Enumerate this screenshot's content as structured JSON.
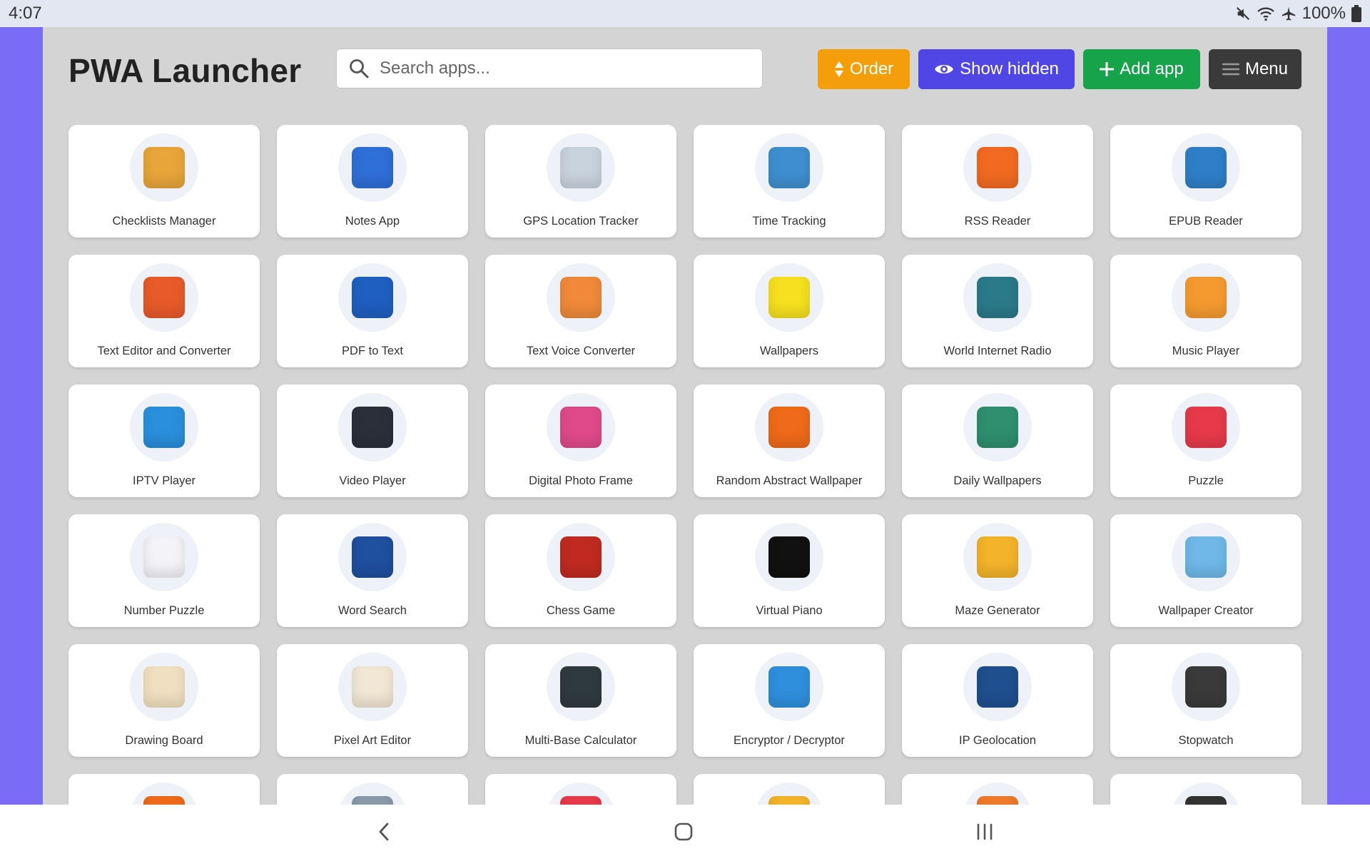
{
  "status": {
    "time": "4:07",
    "battery": "100%"
  },
  "header": {
    "title": "PWA Launcher",
    "search_placeholder": "Search apps...",
    "buttons": {
      "order": "Order",
      "show_hidden": "Show hidden",
      "add_app": "Add app",
      "menu": "Menu"
    }
  },
  "colors": {
    "order": "#f59e0b",
    "show_hidden": "#4f46e5",
    "add_app": "#16a34a",
    "menu": "#3a3a3a",
    "background": "#7b6cf6"
  },
  "apps": [
    {
      "name": "Checklists Manager",
      "icon": "checklist-icon",
      "color": "#e8a53a"
    },
    {
      "name": "Notes App",
      "icon": "notes-icon",
      "color": "#2f6fd8"
    },
    {
      "name": "GPS Location Tracker",
      "icon": "gps-icon",
      "color": "#c9d3dd"
    },
    {
      "name": "Time Tracking",
      "icon": "calendar-clock-icon",
      "color": "#3f8fd0"
    },
    {
      "name": "RSS Reader",
      "icon": "rss-icon",
      "color": "#f26a22"
    },
    {
      "name": "EPUB Reader",
      "icon": "epub-icon",
      "color": "#2f7fc8"
    },
    {
      "name": "Text Editor and Converter",
      "icon": "text-editor-icon",
      "color": "#e85a2a"
    },
    {
      "name": "PDF to Text",
      "icon": "pdf-icon",
      "color": "#1f5fc0"
    },
    {
      "name": "Text Voice Converter",
      "icon": "voice-icon",
      "color": "#f0893a"
    },
    {
      "name": "Wallpapers",
      "icon": "wallpapers-icon",
      "color": "#f6e020"
    },
    {
      "name": "World Internet Radio",
      "icon": "globe-radio-icon",
      "color": "#2b7a8a"
    },
    {
      "name": "Music Player",
      "icon": "music-icon",
      "color": "#f59a30"
    },
    {
      "name": "IPTV Player",
      "icon": "tv-icon",
      "color": "#2a8fdc"
    },
    {
      "name": "Video Player",
      "icon": "video-icon",
      "color": "#2b2f3a"
    },
    {
      "name": "Digital Photo Frame",
      "icon": "photo-frame-icon",
      "color": "#e04a8a"
    },
    {
      "name": "Random Abstract Wallpaper",
      "icon": "abstract-icon",
      "color": "#ef6a1a"
    },
    {
      "name": "Daily Wallpapers",
      "icon": "landscape-icon",
      "color": "#2f8f6f"
    },
    {
      "name": "Puzzle",
      "icon": "puzzle-icon",
      "color": "#e63a4a"
    },
    {
      "name": "Number Puzzle",
      "icon": "number-grid-icon",
      "color": "#f3f3f8"
    },
    {
      "name": "Word Search",
      "icon": "word-search-icon",
      "color": "#1f4f9f"
    },
    {
      "name": "Chess Game",
      "icon": "chess-icon",
      "color": "#c02a20"
    },
    {
      "name": "Virtual Piano",
      "icon": "piano-icon",
      "color": "#111111"
    },
    {
      "name": "Maze Generator",
      "icon": "maze-icon",
      "color": "#f3b32a"
    },
    {
      "name": "Wallpaper Creator",
      "icon": "paint-brush-icon",
      "color": "#6fb8e8"
    },
    {
      "name": "Drawing Board",
      "icon": "drawing-icon",
      "color": "#f0e0c0"
    },
    {
      "name": "Pixel Art Editor",
      "icon": "pixel-art-icon",
      "color": "#f2e6d4"
    },
    {
      "name": "Multi-Base Calculator",
      "icon": "calculator-icon",
      "color": "#2f3a3f"
    },
    {
      "name": "Encryptor / Decryptor",
      "icon": "lock-icon",
      "color": "#2f8fdc"
    },
    {
      "name": "IP Geolocation",
      "icon": "location-globe-icon",
      "color": "#1f4f8f"
    },
    {
      "name": "Stopwatch",
      "icon": "stopwatch-icon",
      "color": "#3a3a3a"
    },
    {
      "name": "",
      "icon": "partial-app-icon",
      "color": "#ef6a1a"
    },
    {
      "name": "",
      "icon": "partial-app-icon",
      "color": "#8a9aaa"
    },
    {
      "name": "",
      "icon": "partial-app-icon",
      "color": "#e63a4a"
    },
    {
      "name": "",
      "icon": "partial-app-icon",
      "color": "#f3b32a"
    },
    {
      "name": "",
      "icon": "partial-app-icon",
      "color": "#ef7a2a"
    },
    {
      "name": "",
      "icon": "partial-app-icon",
      "color": "#333333"
    }
  ]
}
